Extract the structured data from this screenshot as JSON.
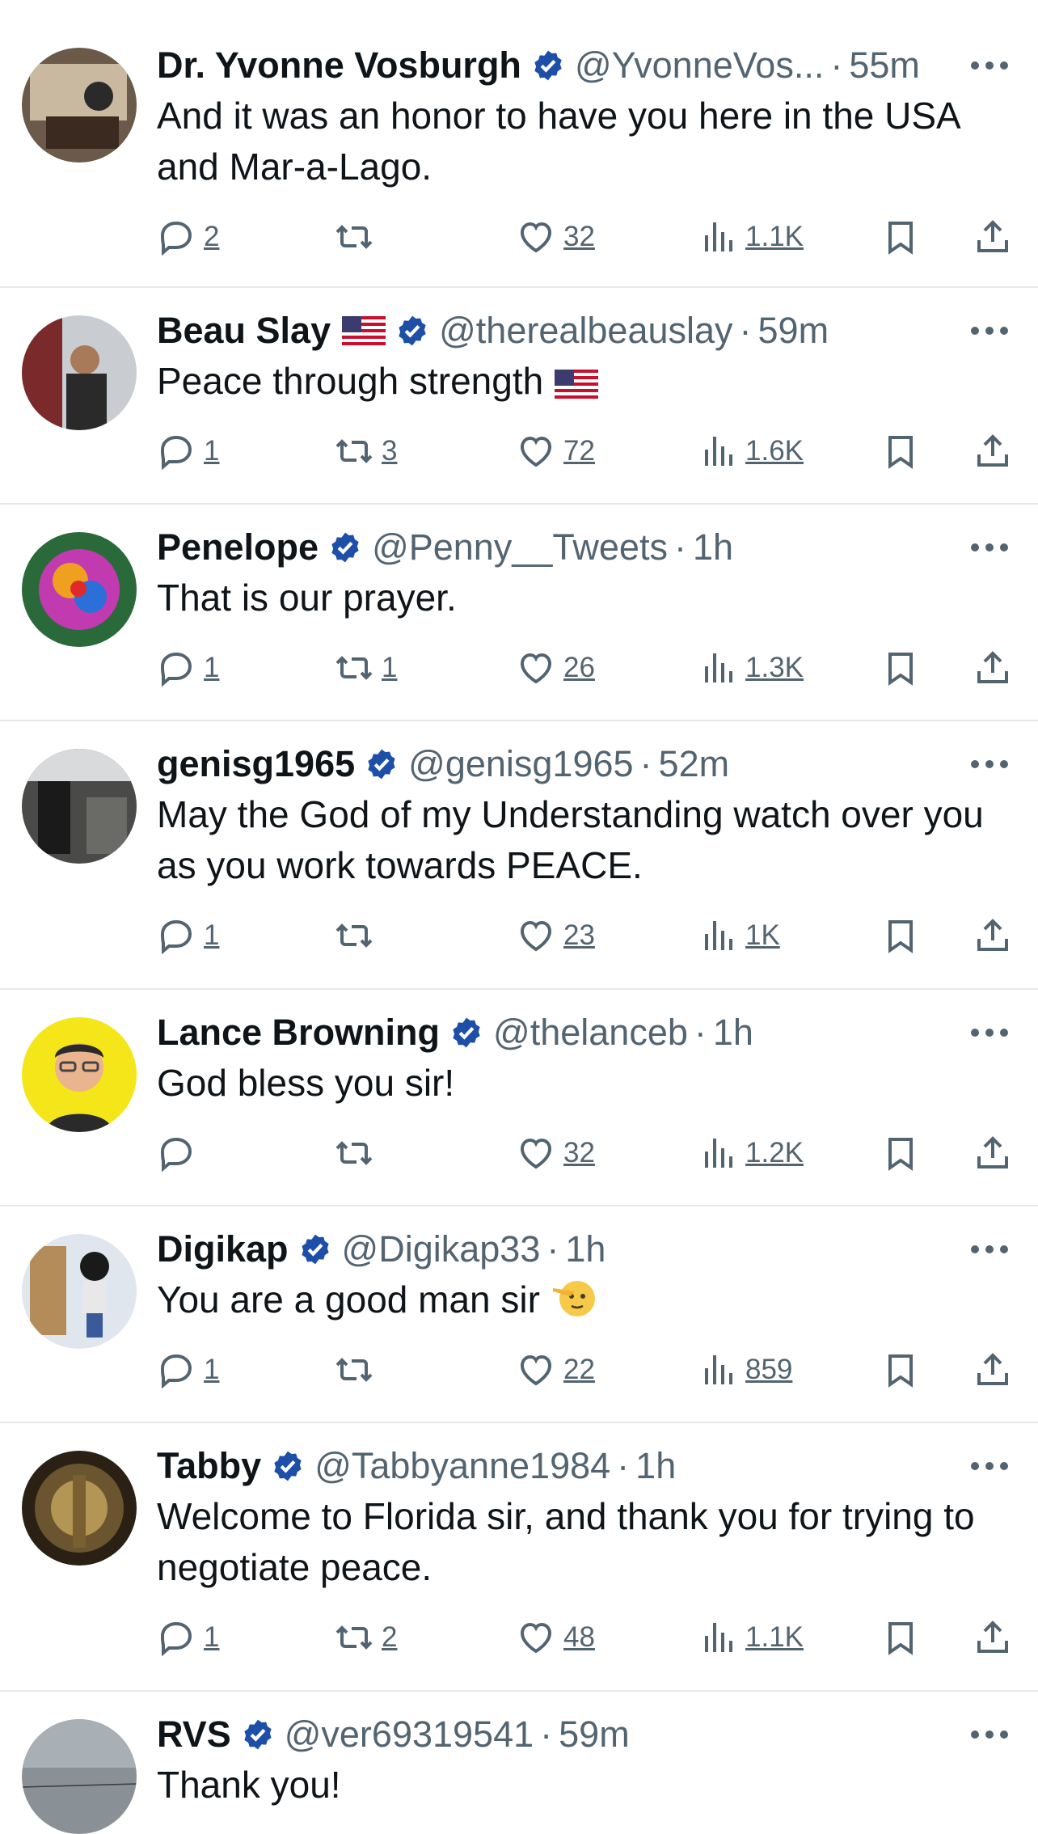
{
  "colors": {
    "verified": "#1d4ea8",
    "secondary_text": "#536471",
    "primary_text": "#0f1419",
    "divider": "#e6e9ec"
  },
  "tweets": [
    {
      "name": "Dr. Yvonne Vosburgh",
      "handle": "@YvonneVos...",
      "time": "55m",
      "text": "And it was an honor to have you here in the USA and Mar-a-Lago.",
      "replies": "2",
      "retweets": "",
      "likes": "32",
      "views": "1.1K"
    },
    {
      "name": "Beau Slay",
      "has_flag": true,
      "handle": "@therealbeauslay",
      "time": "59m",
      "text": "Peace through strength",
      "text_emoji": "us-flag",
      "replies": "1",
      "retweets": "3",
      "likes": "72",
      "views": "1.6K"
    },
    {
      "name": "Penelope",
      "handle": "@Penny__Tweets",
      "time": "1h",
      "text": "That is our prayer.",
      "replies": "1",
      "retweets": "1",
      "likes": "26",
      "views": "1.3K"
    },
    {
      "name": "genisg1965",
      "handle": "@genisg1965",
      "time": "52m",
      "text": "May the God of my Understanding watch over you as you work towards PEACE.",
      "replies": "1",
      "retweets": "",
      "likes": "23",
      "views": "1K"
    },
    {
      "name": "Lance Browning",
      "handle": "@thelanceb",
      "time": "1h",
      "text": "God bless you sir!",
      "replies": "",
      "retweets": "",
      "likes": "32",
      "views": "1.2K"
    },
    {
      "name": "Digikap",
      "handle": "@Digikap33",
      "time": "1h",
      "text": "You are a good man sir",
      "text_emoji": "saluting-face",
      "replies": "1",
      "retweets": "",
      "likes": "22",
      "views": "859"
    },
    {
      "name": "Tabby",
      "handle": "@Tabbyanne1984",
      "time": "1h",
      "text": "Welcome to Florida sir, and thank you for trying to negotiate peace.",
      "replies": "1",
      "retweets": "2",
      "likes": "48",
      "views": "1.1K"
    },
    {
      "name": "RVS",
      "handle": "@ver69319541",
      "time": "59m",
      "text": "Thank you!",
      "replies": "",
      "retweets": "",
      "likes": "",
      "views": ""
    }
  ],
  "separator": "·"
}
